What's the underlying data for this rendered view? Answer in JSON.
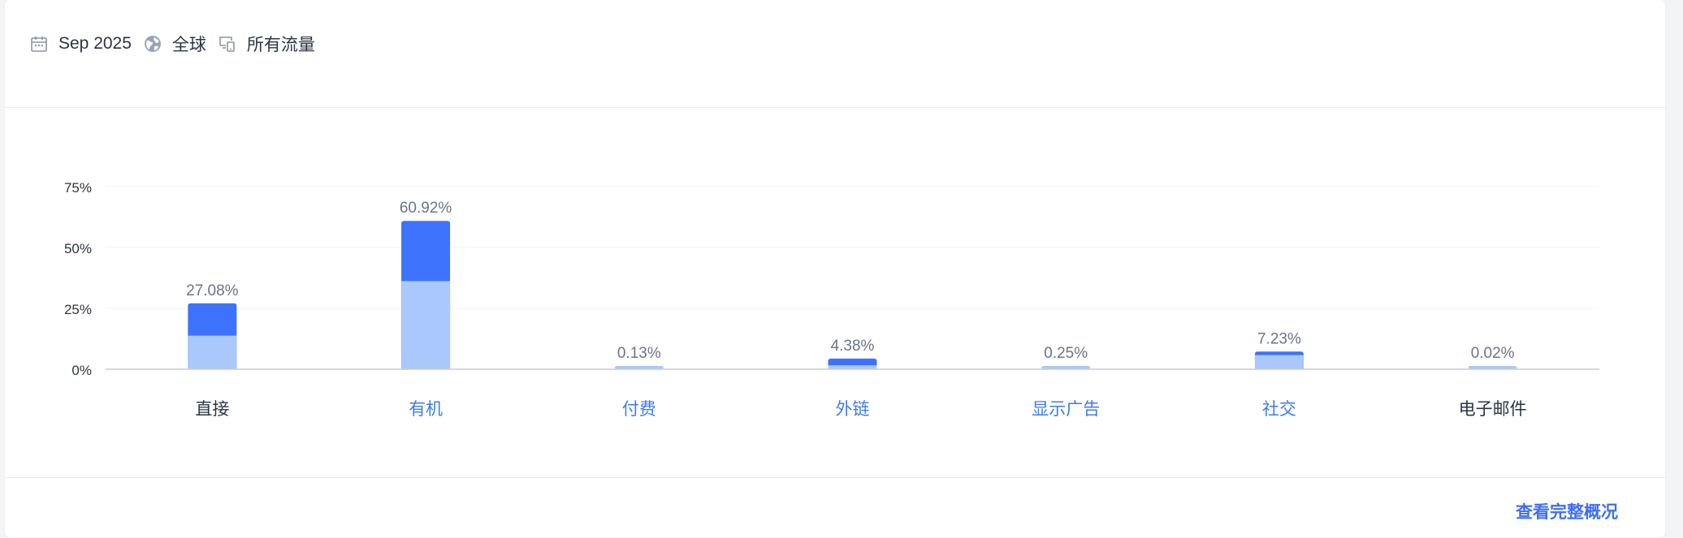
{
  "filters": {
    "date": "Sep 2025",
    "region": "全球",
    "traffic": "所有流量"
  },
  "footer": {
    "link_label": "查看完整概况"
  },
  "colors": {
    "dark_bar": "#3d72fd",
    "light_bar": "#abc8fd",
    "link": "#3d6ef5",
    "category_default": "#2a3444",
    "category_link": "#3d7bf0"
  },
  "chart_data": {
    "type": "bar",
    "stacked": true,
    "categories": [
      "直接",
      "有机",
      "付费",
      "外链",
      "显示广告",
      "社交",
      "电子邮件"
    ],
    "category_links": [
      false,
      true,
      true,
      true,
      true,
      true,
      false
    ],
    "totals": [
      27.08,
      60.92,
      0.13,
      4.38,
      0.25,
      7.23,
      0.02
    ],
    "data_labels": [
      "27.08%",
      "60.92%",
      "0.13%",
      "4.38%",
      "0.25%",
      "7.23%",
      "0.02%"
    ],
    "series": [
      {
        "values": [
          13.8,
          36.2,
          0.13,
          1.6,
          0.25,
          5.8,
          0.02
        ]
      },
      {
        "values": [
          13.28,
          24.72,
          0.0,
          2.78,
          0.0,
          1.43,
          0.0
        ]
      }
    ],
    "yticks": [
      "0%",
      "25%",
      "50%",
      "75%"
    ],
    "ytick_values": [
      0,
      25,
      50,
      75
    ],
    "ylim": [
      0,
      75
    ],
    "grid": true
  }
}
